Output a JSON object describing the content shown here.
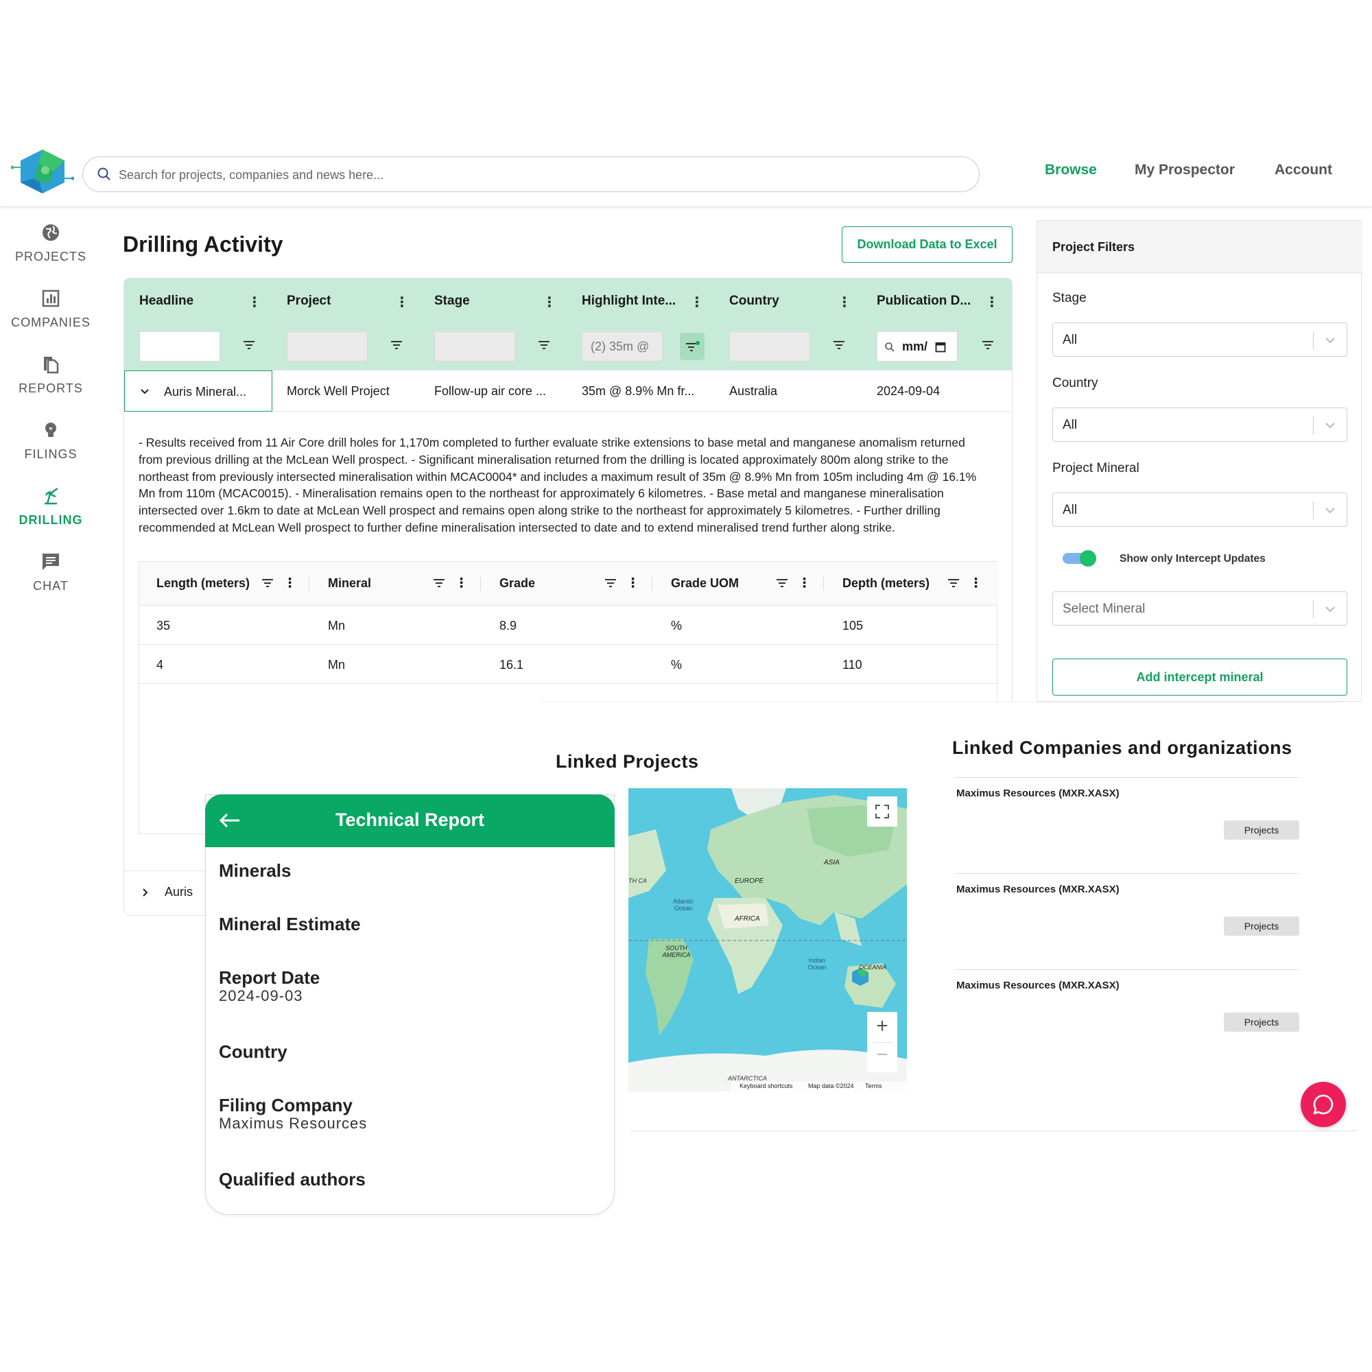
{
  "header": {
    "search_placeholder": "Search for projects, companies and news here...",
    "nav": [
      "Browse",
      "My Prospector",
      "Account"
    ]
  },
  "sidebar": {
    "items": [
      {
        "label": "PROJECTS",
        "icon": "globe-icon"
      },
      {
        "label": "COMPANIES",
        "icon": "bar-chart-icon"
      },
      {
        "label": "REPORTS",
        "icon": "documents-icon"
      },
      {
        "label": "FILINGS",
        "icon": "lightbulb-icon"
      },
      {
        "label": "DRILLING",
        "icon": "drill-icon"
      },
      {
        "label": "CHAT",
        "icon": "chat-icon"
      }
    ],
    "active": "DRILLING"
  },
  "page": {
    "title": "Drilling Activity",
    "download_label": "Download Data to Excel"
  },
  "grid": {
    "columns": [
      "Headline",
      "Project",
      "Stage",
      "Highlight Inte...",
      "Country",
      "Publication D..."
    ],
    "filters": {
      "highlight_value": "(2) 35m @",
      "date_placeholder": "mm/"
    },
    "row1": {
      "headline": "Auris Mineral...",
      "project": "Morck Well Project",
      "stage": "Follow-up air core ...",
      "highlight": "35m @ 8.9% Mn fr...",
      "country": "Australia",
      "date": "2024-09-04"
    },
    "detail": "- Results received from 11 Air Core drill holes for 1,170m completed to further evaluate strike extensions to base metal and manganese anomalism returned from previous drilling at the McLean Well prospect. - Significant mineralisation returned from the drilling is located approximately 800m along strike to the northeast from previously intersected mineralisation within MCAC0004* and includes a maximum result of 35m @ 8.9% Mn from 105m including 4m @ 16.1% Mn from 110m (MCAC0015). - Mineralisation remains open to the northeast for approximately 6 kilometres. - Base metal and manganese mineralisation intersected over 1.6km to date at McLean Well prospect and remains open along strike to the northeast for approximately 5 kilometres. - Further drilling recommended at McLean Well prospect to further define mineralisation intersected to date and to extend mineralised trend further along strike.",
    "sub_columns": [
      "Length (meters)",
      "Mineral",
      "Grade",
      "Grade UOM",
      "Depth (meters)"
    ],
    "sub_rows": [
      [
        "35",
        "Mn",
        "8.9",
        "%",
        "105"
      ],
      [
        "4",
        "Mn",
        "16.1",
        "%",
        "110"
      ]
    ],
    "row2_headline": "Auris"
  },
  "filters_panel": {
    "title": "Project Filters",
    "stage_label": "Stage",
    "stage_value": "All",
    "country_label": "Country",
    "country_value": "All",
    "mineral_label": "Project Mineral",
    "mineral_value": "All",
    "toggle_label": "Show only Intercept Updates",
    "toggle_on": true,
    "select_mineral_placeholder": "Select Mineral",
    "add_button": "Add intercept mineral"
  },
  "linked": {
    "projects_title": "Linked Projects",
    "companies_title": "Linked Companies and organizations",
    "companies": [
      {
        "name": "Maximus Resources (MXR.XASX)",
        "button": "Projects"
      },
      {
        "name": "Maximus Resources (MXR.XASX)",
        "button": "Projects"
      },
      {
        "name": "Maximus Resources (MXR.XASX)",
        "button": "Projects"
      }
    ]
  },
  "map": {
    "labels": {
      "europe": "EUROPE",
      "asia": "ASIA",
      "africa": "AFRICA",
      "atlantic": "Atlantic Ocean",
      "indian": "Indian Ocean",
      "south_america": "SOUTH AMERICA",
      "oceania": "OCEANIA",
      "antarctica": "ANTARCTICA",
      "north_america_fragment": "TH CA"
    },
    "footer": [
      "Keyboard shortcuts",
      "Map data ©2024",
      "Terms"
    ],
    "zoom_in": "+",
    "zoom_out": "−"
  },
  "tech_report": {
    "title": "Technical Report",
    "items": [
      {
        "label": "Minerals",
        "value": ""
      },
      {
        "label": "Mineral Estimate",
        "value": ""
      },
      {
        "label": "Report Date",
        "value": "2024-09-03"
      },
      {
        "label": "Country",
        "value": ""
      },
      {
        "label": "Filing Company",
        "value": "Maximus Resources"
      },
      {
        "label": "Qualified authors",
        "value": ""
      }
    ]
  },
  "colors": {
    "accent": "#12a160",
    "grid_header": "#c8ead8",
    "fab": "#ed1f5a"
  }
}
